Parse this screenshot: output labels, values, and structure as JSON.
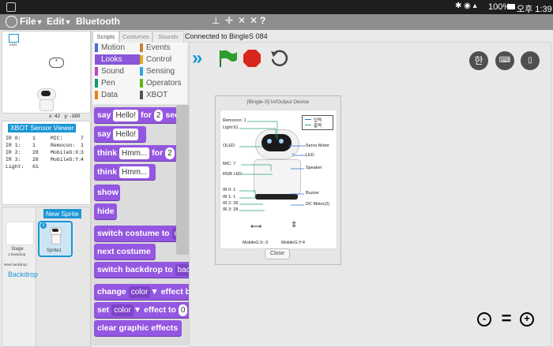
{
  "status_bar": {
    "battery": "100%",
    "time": "오후 1:39"
  },
  "menu": {
    "file": "File",
    "edit": "Edit",
    "bluetooth": "Bluetooth"
  },
  "stage_size": "x42x",
  "sprite_coords": {
    "x_label": "x:",
    "x": "42",
    "y_label": "y:",
    "y": "-180"
  },
  "sensor_viewer": {
    "title": "XBOT Sensor Viewer",
    "rows": [
      {
        "l": "IR 0:",
        "lv": "1",
        "r": "MIC:",
        "rv": "7"
      },
      {
        "l": "IR 1:",
        "lv": "1",
        "r": "Remocon:",
        "rv": "1"
      },
      {
        "l": "IR 2:",
        "lv": "28",
        "r": "MobileG:X:",
        "rv": "3"
      },
      {
        "l": "IR 3:",
        "lv": "28",
        "r": "MobileG:Y:",
        "rv": "4"
      },
      {
        "l": "Light:",
        "lv": "61",
        "r": "",
        "rv": ""
      }
    ]
  },
  "sprites": {
    "new_sprite": "New Sprite",
    "stage_label": "Stage",
    "stage_sub": "1 backdrop",
    "new_backdrop": "New backdrop:",
    "backdrop_button": "Backdrop",
    "sprite_name": "Sprite1"
  },
  "tabs": {
    "scripts": "Scripts",
    "costumes": "Costumes",
    "sounds": "Sounds"
  },
  "connection": "Connected to BingleS 084",
  "categories": [
    {
      "name": "Motion",
      "color": "#4a6cd4"
    },
    {
      "name": "Events",
      "color": "#c88330"
    },
    {
      "name": "Looks",
      "color": "#8a55d7"
    },
    {
      "name": "Control",
      "color": "#e1a91a"
    },
    {
      "name": "Sound",
      "color": "#bb42c3"
    },
    {
      "name": "Sensing",
      "color": "#2ca5e2"
    },
    {
      "name": "Pen",
      "color": "#0e9a6c"
    },
    {
      "name": "Operators",
      "color": "#5cb712"
    },
    {
      "name": "Data",
      "color": "#ee7d16"
    },
    {
      "name": "XBOT",
      "color": "#555555"
    }
  ],
  "blocks": {
    "say_for": "say",
    "say_for_text": "Hello!",
    "say_for_for": "for",
    "say_for_num": "2",
    "say_for_secs": "secs",
    "say": "say",
    "say_text": "Hello!",
    "think_for": "think",
    "think_for_text": "Hmm...",
    "think_for_for": "for",
    "think_for_num": "2",
    "think_for_secs": "se",
    "think": "think",
    "think_text": "Hmm...",
    "show": "show",
    "hide": "hide",
    "switch_costume": "switch costume to",
    "switch_costume_val": "costu",
    "next_costume": "next costume",
    "switch_backdrop": "switch backdrop to",
    "switch_backdrop_val": "back",
    "change_effect": "change",
    "change_effect_dd": "color",
    "change_effect_by": "effect b",
    "set_effect": "set",
    "set_effect_dd": "color",
    "set_effect_to": "effect to",
    "set_effect_num": "0",
    "clear_effects": "clear graphic effects"
  },
  "lang_button": "한",
  "dialog": {
    "title": "[Bingle-S] In/Output Device",
    "legend_in": "입력",
    "legend_out": "출력",
    "labels_left": [
      "Remocon: 1",
      "Light:61",
      "OLED",
      "MIC: 7",
      "RGB LED",
      "IR 0: 1",
      "IR 1: 1",
      "IR 2: 28",
      "IR 3: 28"
    ],
    "labels_right": [
      "Servo Motor",
      "LED",
      "Speaker",
      "Buzzer",
      "DC Motor(2)"
    ],
    "mobile_x": "MobileG:X:-3",
    "mobile_y": "MobileG:Y:4",
    "close": "Close"
  },
  "zoom": {
    "out": "-",
    "reset": "=",
    "in": "+"
  },
  "colors": {
    "looks_block": "#9457e1",
    "accent_blue": "#1b96d6",
    "go_green": "#2a9d2a",
    "stop_red": "#d9261c"
  }
}
